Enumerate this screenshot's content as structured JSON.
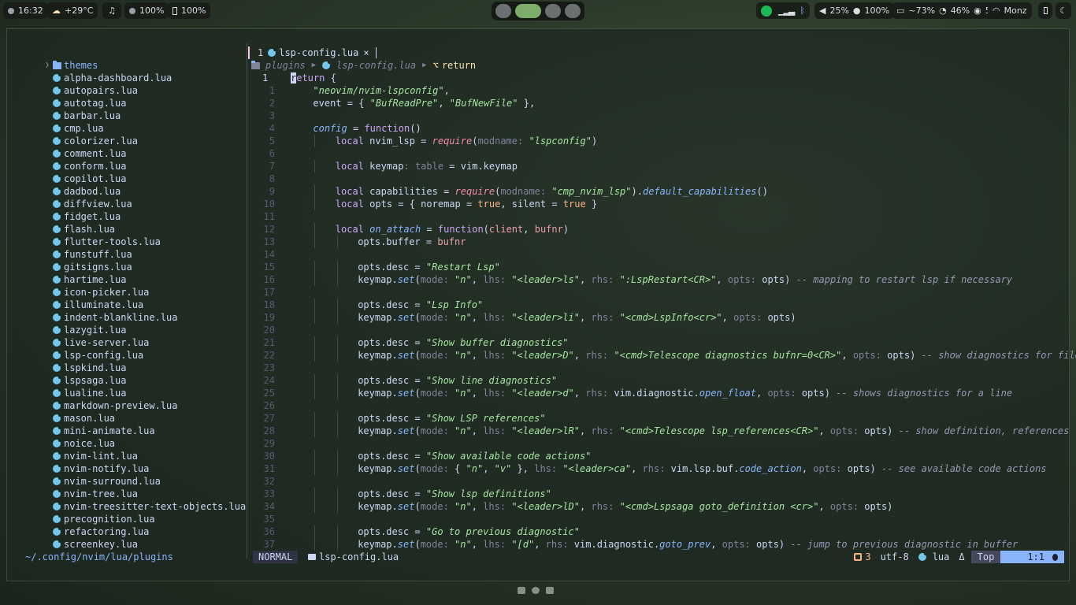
{
  "topbar": {
    "time": "16:32",
    "weather": "+29°C",
    "volume_small": "100%",
    "battery_small": "100%",
    "volume": "25%",
    "mic": "100%",
    "memory": "~73%",
    "cpu": "46%",
    "disk": "5%",
    "wifi": "Monz"
  },
  "tree": {
    "folder": "themes",
    "files": [
      "alpha-dashboard.lua",
      "autopairs.lua",
      "autotag.lua",
      "barbar.lua",
      "cmp.lua",
      "colorizer.lua",
      "comment.lua",
      "conform.lua",
      "copilot.lua",
      "dadbod.lua",
      "diffview.lua",
      "fidget.lua",
      "flash.lua",
      "flutter-tools.lua",
      "funstuff.lua",
      "gitsigns.lua",
      "hartime.lua",
      "icon-picker.lua",
      "illuminate.lua",
      "indent-blankline.lua",
      "lazygit.lua",
      "live-server.lua",
      "lsp-config.lua",
      "lspkind.lua",
      "lspsaga.lua",
      "lualine.lua",
      "markdown-preview.lua",
      "mason.lua",
      "mini-animate.lua",
      "noice.lua",
      "nvim-lint.lua",
      "nvim-notify.lua",
      "nvim-surround.lua",
      "nvim-tree.lua",
      "nvim-treesitter-text-objects.lua",
      "precognition.lua",
      "refactoring.lua",
      "screenkey.lua"
    ],
    "path": "~/.config/nvim/lua/plugins"
  },
  "tab": {
    "number": "1",
    "name": "lsp-config.lua",
    "close": "×"
  },
  "winbar": {
    "crumb1": "plugins",
    "crumb2": "lsp-config.lua",
    "crumb3": "return"
  },
  "editor": {
    "lines": [
      {
        "n": "1",
        "indent": 0,
        "tokens": [
          [
            "cursor",
            "r"
          ],
          [
            "kw",
            "eturn"
          ],
          [
            "var",
            " {"
          ]
        ]
      },
      {
        "n": "1",
        "indent": 1,
        "tokens": [
          [
            "str",
            "\"neovim/nvim-lspconfig\""
          ],
          [
            "var",
            ","
          ]
        ]
      },
      {
        "n": "2",
        "indent": 1,
        "tokens": [
          [
            "var",
            "event = { "
          ],
          [
            "str",
            "\"BufReadPre\""
          ],
          [
            "var",
            ", "
          ],
          [
            "str",
            "\"BufNewFile\""
          ],
          [
            "var",
            " },"
          ]
        ]
      },
      {
        "n": "3",
        "indent": 0,
        "tokens": []
      },
      {
        "n": "4",
        "indent": 1,
        "tokens": [
          [
            "fn",
            "config"
          ],
          [
            "var",
            " = "
          ],
          [
            "kw",
            "function"
          ],
          [
            "var",
            "()"
          ]
        ]
      },
      {
        "n": "5",
        "indent": 2,
        "tokens": [
          [
            "kw",
            "local"
          ],
          [
            "var",
            " nvim_lsp = "
          ],
          [
            "req",
            "require"
          ],
          [
            "var",
            "("
          ],
          [
            "param",
            "modname: "
          ],
          [
            "str",
            "\"lspconfig\""
          ],
          [
            "var",
            ")"
          ]
        ]
      },
      {
        "n": "6",
        "indent": 0,
        "tokens": []
      },
      {
        "n": "7",
        "indent": 2,
        "tokens": [
          [
            "kw",
            "local"
          ],
          [
            "var",
            " keymap"
          ],
          [
            "param",
            ": table"
          ],
          [
            "var",
            " = vim.keymap"
          ]
        ]
      },
      {
        "n": "8",
        "indent": 0,
        "tokens": []
      },
      {
        "n": "9",
        "indent": 2,
        "tokens": [
          [
            "kw",
            "local"
          ],
          [
            "var",
            " capabilities = "
          ],
          [
            "req",
            "require"
          ],
          [
            "var",
            "("
          ],
          [
            "param",
            "modname: "
          ],
          [
            "str",
            "\"cmp_nvim_lsp\""
          ],
          [
            "var",
            ")."
          ],
          [
            "fn",
            "default_capabilities"
          ],
          [
            "var",
            "()"
          ]
        ]
      },
      {
        "n": "10",
        "indent": 2,
        "tokens": [
          [
            "kw",
            "local"
          ],
          [
            "var",
            " opts = { "
          ],
          [
            "var",
            "noremap = "
          ],
          [
            "bool",
            "true"
          ],
          [
            "var",
            ", silent = "
          ],
          [
            "bool",
            "true"
          ],
          [
            "var",
            " }"
          ]
        ]
      },
      {
        "n": "11",
        "indent": 0,
        "tokens": []
      },
      {
        "n": "12",
        "indent": 2,
        "tokens": [
          [
            "kw",
            "local"
          ],
          [
            "var",
            " "
          ],
          [
            "fn",
            "on_attach"
          ],
          [
            "var",
            " = "
          ],
          [
            "kw",
            "function"
          ],
          [
            "var",
            "("
          ],
          [
            "arg",
            "client"
          ],
          [
            "var",
            ", "
          ],
          [
            "arg",
            "bufnr"
          ],
          [
            "var",
            ")"
          ]
        ]
      },
      {
        "n": "13",
        "indent": 3,
        "tokens": [
          [
            "var",
            "opts.buffer = "
          ],
          [
            "arg",
            "bufnr"
          ]
        ]
      },
      {
        "n": "14",
        "indent": 0,
        "tokens": []
      },
      {
        "n": "15",
        "indent": 3,
        "tokens": [
          [
            "var",
            "opts.desc = "
          ],
          [
            "str",
            "\"Restart Lsp\""
          ]
        ]
      },
      {
        "n": "16",
        "indent": 3,
        "tokens": [
          [
            "var",
            "keymap."
          ],
          [
            "fn",
            "set"
          ],
          [
            "var",
            "("
          ],
          [
            "param",
            "mode: "
          ],
          [
            "str",
            "\"n\""
          ],
          [
            "var",
            ", "
          ],
          [
            "param",
            "lhs: "
          ],
          [
            "str",
            "\"<leader>ls\""
          ],
          [
            "var",
            ", "
          ],
          [
            "param",
            "rhs: "
          ],
          [
            "str",
            "\":LspRestart<CR>\""
          ],
          [
            "var",
            ", "
          ],
          [
            "param",
            "opts: "
          ],
          [
            "var",
            "opts) "
          ],
          [
            "cmt",
            "-- mapping to restart lsp if necessary"
          ]
        ]
      },
      {
        "n": "17",
        "indent": 0,
        "tokens": []
      },
      {
        "n": "18",
        "indent": 3,
        "tokens": [
          [
            "var",
            "opts.desc = "
          ],
          [
            "str",
            "\"Lsp Info\""
          ]
        ]
      },
      {
        "n": "19",
        "indent": 3,
        "tokens": [
          [
            "var",
            "keymap."
          ],
          [
            "fn",
            "set"
          ],
          [
            "var",
            "("
          ],
          [
            "param",
            "mode: "
          ],
          [
            "str",
            "\"n\""
          ],
          [
            "var",
            ", "
          ],
          [
            "param",
            "lhs: "
          ],
          [
            "str",
            "\"<leader>li\""
          ],
          [
            "var",
            ", "
          ],
          [
            "param",
            "rhs: "
          ],
          [
            "str",
            "\"<cmd>LspInfo<cr>\""
          ],
          [
            "var",
            ", "
          ],
          [
            "param",
            "opts: "
          ],
          [
            "var",
            "opts)"
          ]
        ]
      },
      {
        "n": "20",
        "indent": 0,
        "tokens": []
      },
      {
        "n": "21",
        "indent": 3,
        "tokens": [
          [
            "var",
            "opts.desc = "
          ],
          [
            "str",
            "\"Show buffer diagnostics\""
          ]
        ]
      },
      {
        "n": "22",
        "indent": 3,
        "tokens": [
          [
            "var",
            "keymap."
          ],
          [
            "fn",
            "set"
          ],
          [
            "var",
            "("
          ],
          [
            "param",
            "mode: "
          ],
          [
            "str",
            "\"n\""
          ],
          [
            "var",
            ", "
          ],
          [
            "param",
            "lhs: "
          ],
          [
            "str",
            "\"<leader>D\""
          ],
          [
            "var",
            ", "
          ],
          [
            "param",
            "rhs: "
          ],
          [
            "str",
            "\"<cmd>Telescope diagnostics bufnr=0<CR>\""
          ],
          [
            "var",
            ", "
          ],
          [
            "param",
            "opts: "
          ],
          [
            "var",
            "opts) "
          ],
          [
            "cmt",
            "-- show diagnostics for file"
          ]
        ]
      },
      {
        "n": "23",
        "indent": 0,
        "tokens": []
      },
      {
        "n": "24",
        "indent": 3,
        "tokens": [
          [
            "var",
            "opts.desc = "
          ],
          [
            "str",
            "\"Show line diagnostics\""
          ]
        ]
      },
      {
        "n": "25",
        "indent": 3,
        "tokens": [
          [
            "var",
            "keymap."
          ],
          [
            "fn",
            "set"
          ],
          [
            "var",
            "("
          ],
          [
            "param",
            "mode: "
          ],
          [
            "str",
            "\"n\""
          ],
          [
            "var",
            ", "
          ],
          [
            "param",
            "lhs: "
          ],
          [
            "str",
            "\"<leader>d\""
          ],
          [
            "var",
            ", "
          ],
          [
            "param",
            "rhs: "
          ],
          [
            "var",
            "vim.diagnostic."
          ],
          [
            "fn",
            "open_float"
          ],
          [
            "var",
            ", "
          ],
          [
            "param",
            "opts: "
          ],
          [
            "var",
            "opts) "
          ],
          [
            "cmt",
            "-- shows diagnostics for a line"
          ]
        ]
      },
      {
        "n": "26",
        "indent": 0,
        "tokens": []
      },
      {
        "n": "27",
        "indent": 3,
        "tokens": [
          [
            "var",
            "opts.desc = "
          ],
          [
            "str",
            "\"Show LSP references\""
          ]
        ]
      },
      {
        "n": "28",
        "indent": 3,
        "tokens": [
          [
            "var",
            "keymap."
          ],
          [
            "fn",
            "set"
          ],
          [
            "var",
            "("
          ],
          [
            "param",
            "mode: "
          ],
          [
            "str",
            "\"n\""
          ],
          [
            "var",
            ", "
          ],
          [
            "param",
            "lhs: "
          ],
          [
            "str",
            "\"<leader>lR\""
          ],
          [
            "var",
            ", "
          ],
          [
            "param",
            "rhs: "
          ],
          [
            "str",
            "\"<cmd>Telescope lsp_references<CR>\""
          ],
          [
            "var",
            ", "
          ],
          [
            "param",
            "opts: "
          ],
          [
            "var",
            "opts) "
          ],
          [
            "cmt",
            "-- show definition, references"
          ]
        ]
      },
      {
        "n": "29",
        "indent": 0,
        "tokens": []
      },
      {
        "n": "30",
        "indent": 3,
        "tokens": [
          [
            "var",
            "opts.desc = "
          ],
          [
            "str",
            "\"Show available code actions\""
          ]
        ]
      },
      {
        "n": "31",
        "indent": 3,
        "tokens": [
          [
            "var",
            "keymap."
          ],
          [
            "fn",
            "set"
          ],
          [
            "var",
            "("
          ],
          [
            "param",
            "mode: "
          ],
          [
            "var",
            "{ "
          ],
          [
            "str",
            "\"n\""
          ],
          [
            "var",
            ", "
          ],
          [
            "str",
            "\"v\""
          ],
          [
            "var",
            " }, "
          ],
          [
            "param",
            "lhs: "
          ],
          [
            "str",
            "\"<leader>ca\""
          ],
          [
            "var",
            ", "
          ],
          [
            "param",
            "rhs: "
          ],
          [
            "var",
            "vim.lsp.buf."
          ],
          [
            "fn",
            "code_action"
          ],
          [
            "var",
            ", "
          ],
          [
            "param",
            "opts: "
          ],
          [
            "var",
            "opts) "
          ],
          [
            "cmt",
            "-- see available code actions"
          ]
        ]
      },
      {
        "n": "32",
        "indent": 0,
        "tokens": []
      },
      {
        "n": "33",
        "indent": 3,
        "tokens": [
          [
            "var",
            "opts.desc = "
          ],
          [
            "str",
            "\"Show lsp definitions\""
          ]
        ]
      },
      {
        "n": "34",
        "indent": 3,
        "tokens": [
          [
            "var",
            "keymap."
          ],
          [
            "fn",
            "set"
          ],
          [
            "var",
            "("
          ],
          [
            "param",
            "mode: "
          ],
          [
            "str",
            "\"n\""
          ],
          [
            "var",
            ", "
          ],
          [
            "param",
            "lhs: "
          ],
          [
            "str",
            "\"<leader>lD\""
          ],
          [
            "var",
            ", "
          ],
          [
            "param",
            "rhs: "
          ],
          [
            "str",
            "\"<cmd>Lspsaga goto_definition <cr>\""
          ],
          [
            "var",
            ", "
          ],
          [
            "param",
            "opts: "
          ],
          [
            "var",
            "opts)"
          ]
        ]
      },
      {
        "n": "35",
        "indent": 0,
        "tokens": []
      },
      {
        "n": "36",
        "indent": 3,
        "tokens": [
          [
            "var",
            "opts.desc = "
          ],
          [
            "str",
            "\"Go to previous diagnostic\""
          ]
        ]
      },
      {
        "n": "37",
        "indent": 3,
        "tokens": [
          [
            "var",
            "keymap."
          ],
          [
            "fn",
            "set"
          ],
          [
            "var",
            "("
          ],
          [
            "param",
            "mode: "
          ],
          [
            "str",
            "\"n\""
          ],
          [
            "var",
            ", "
          ],
          [
            "param",
            "lhs: "
          ],
          [
            "str",
            "\"[d\""
          ],
          [
            "var",
            ", "
          ],
          [
            "param",
            "rhs: "
          ],
          [
            "var",
            "vim.diagnostic."
          ],
          [
            "fn",
            "goto_prev"
          ],
          [
            "var",
            ", "
          ],
          [
            "param",
            "opts: "
          ],
          [
            "var",
            "opts) "
          ],
          [
            "cmt",
            "-- jump to previous diagnostic in buffer"
          ]
        ]
      }
    ]
  },
  "status": {
    "mode": "NORMAL",
    "file": "lsp-config.lua",
    "lsp_count": "3",
    "encoding": "utf-8",
    "filetype": "lua",
    "position_label": "Top",
    "cursor": "1:1"
  },
  "colors": {
    "accent": "#89b4fa",
    "string": "#a6e3a1",
    "keyword": "#cba6f7",
    "mode_bg": "#313244"
  }
}
